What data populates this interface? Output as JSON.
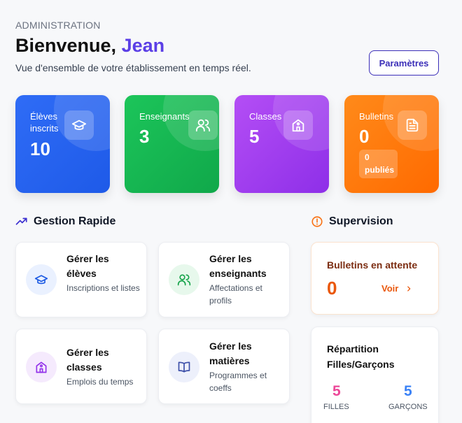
{
  "header": {
    "eyebrow": "ADMINISTRATION",
    "greeting": "Bienvenue,",
    "user_name": "Jean",
    "subtitle": "Vue d'ensemble de votre établissement en temps réel.",
    "settings_label": "Paramètres"
  },
  "stats": [
    {
      "label": "Élèves inscrits",
      "value": "10",
      "icon": "graduation-cap-icon",
      "color": "#2563eb"
    },
    {
      "label": "Enseignants",
      "value": "3",
      "icon": "users-icon",
      "color": "#16a34a"
    },
    {
      "label": "Classes",
      "value": "5",
      "icon": "school-icon",
      "color": "#9333ea"
    },
    {
      "label": "Bulletins",
      "value": "0",
      "icon": "document-icon",
      "color": "#f97316",
      "published_count": "0",
      "published_label": "publiés"
    }
  ],
  "quick": {
    "title": "Gestion Rapide",
    "items": [
      {
        "title": "Gérer les élèves",
        "desc": "Inscriptions et listes",
        "icon": "graduation-cap-icon"
      },
      {
        "title": "Gérer les enseignants",
        "desc": "Affectations et profils",
        "icon": "users-icon"
      },
      {
        "title": "Gérer les classes",
        "desc": "Emplois du temps",
        "icon": "school-icon"
      },
      {
        "title": "Gérer les matières",
        "desc": "Programmes et coeffs",
        "icon": "book-icon"
      }
    ]
  },
  "supervision": {
    "title": "Supervision",
    "pending_title": "Bulletins en attente",
    "pending_value": "0",
    "view_label": "Voir",
    "repartition_title": "Répartition Filles/Garçons",
    "girls_value": "5",
    "girls_label": "FILLES",
    "boys_value": "5",
    "boys_label": "GARÇONS"
  }
}
